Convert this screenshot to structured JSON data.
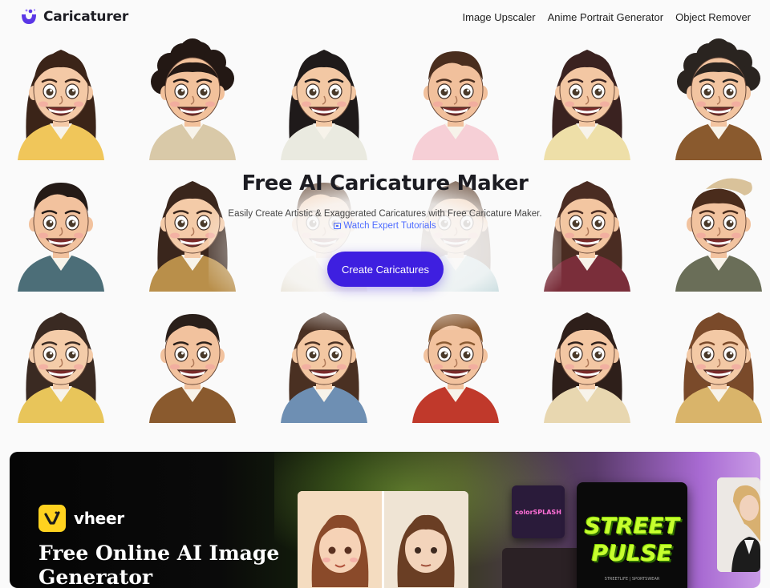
{
  "header": {
    "brand": "Caricaturer",
    "nav": [
      "Image Upscaler",
      "Anime Portrait Generator",
      "Object Remover"
    ]
  },
  "hero": {
    "title": "Free AI Caricature Maker",
    "subtitle": "Easily Create Artistic & Exaggerated Caricatures with Free Caricature Maker.",
    "tutorial_link": "Watch Expert Tutorials",
    "cta": "Create Caricatures"
  },
  "banner": {
    "brand": "vheer",
    "title": "Free Online AI Image Generator",
    "card_colorsplash": "colorSPLASH",
    "card_street": "STREET",
    "card_pulse": "PULSE",
    "card_small": "STREETLIFE | SPORTSWEAR"
  },
  "colors": {
    "accent": "#3e1fe0",
    "link": "#4d6bff",
    "vheer_yellow": "#ffd21f",
    "logo_purple": "#5a36e6"
  },
  "portraits": [
    {
      "hair": "#3b2418",
      "skin": "#f4c9a6",
      "shirt": "#f0c65a",
      "style": "long"
    },
    {
      "hair": "#231814",
      "skin": "#f2c19b",
      "shirt": "#d9c9a8",
      "style": "curly"
    },
    {
      "hair": "#1f1a1a",
      "skin": "#f3c8a4",
      "shirt": "#eaeae0",
      "style": "long"
    },
    {
      "hair": "#4a2e1e",
      "skin": "#f1c09c",
      "shirt": "#f6cfd6",
      "style": "short"
    },
    {
      "hair": "#3a2220",
      "skin": "#f3c7a3",
      "shirt": "#eedfa8",
      "style": "long"
    },
    {
      "hair": "#2a2420",
      "skin": "#f2c4a0",
      "shirt": "#8a5a2e",
      "style": "curly"
    },
    {
      "hair": "#241a16",
      "skin": "#f2c29e",
      "shirt": "#4c6e78",
      "style": "short"
    },
    {
      "hair": "#3a261c",
      "skin": "#f4cba8",
      "shirt": "#b98f4a",
      "style": "long"
    },
    {
      "hair": "#5a3c28",
      "skin": "#f1c6a2",
      "shirt": "#d8cdb4",
      "style": "short"
    },
    {
      "hair": "#5a3c28",
      "skin": "#f1c6a2",
      "shirt": "#9fc4c9",
      "style": "long"
    },
    {
      "hair": "#4a2c22",
      "skin": "#f3c6a1",
      "shirt": "#7a2e3a",
      "style": "long"
    },
    {
      "hair": "#4a2c1c",
      "skin": "#f2c39f",
      "shirt": "#6a6e58",
      "style": "hat"
    },
    {
      "hair": "#3a2a22",
      "skin": "#f4cca9",
      "shirt": "#e8c55a",
      "style": "long"
    },
    {
      "hair": "#2a1f1a",
      "skin": "#f2c29e",
      "shirt": "#8a5a2e",
      "style": "short"
    },
    {
      "hair": "#4a3022",
      "skin": "#f3c7a2",
      "shirt": "#6e8fb3",
      "style": "long"
    },
    {
      "hair": "#8a5a32",
      "skin": "#f2c29e",
      "shirt": "#c0392b",
      "style": "short"
    },
    {
      "hair": "#2e1f1a",
      "skin": "#f3c7a3",
      "shirt": "#e8d7b0",
      "style": "long"
    },
    {
      "hair": "#7a4a2a",
      "skin": "#f3c9a5",
      "shirt": "#d9b46a",
      "style": "long"
    }
  ]
}
